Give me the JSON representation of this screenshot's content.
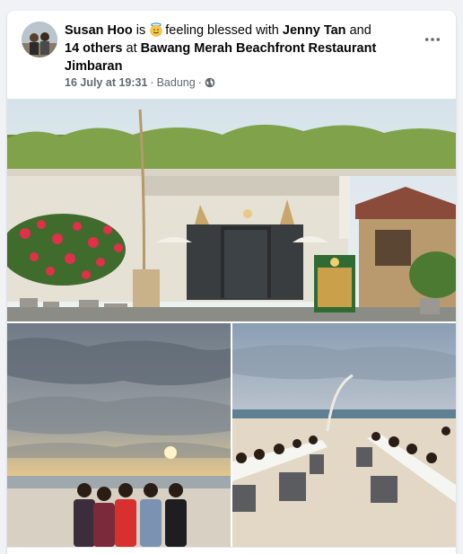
{
  "post": {
    "author": "Susan Hoo",
    "connector_is": "is",
    "activity": "feeling blessed",
    "feeling_icon": "smiling-face-with-halo-icon",
    "with_word": "with",
    "tagged_person": "Jenny Tan",
    "and_word": "and",
    "others": "14 others",
    "at_word": "at",
    "place": "Bawang Merah Beachfront Restaurant Jimbaran",
    "date": "16 July at 19:31",
    "separator": "·",
    "location": "Badung",
    "audience_separator": "·",
    "audience_icon": "globe-icon",
    "more_icon": "more-options-icon"
  },
  "photos": [
    {
      "subject": "restaurant-entrance-photo"
    },
    {
      "subject": "beach-sunset-group-photo"
    },
    {
      "subject": "beach-dinner-tables-photo"
    }
  ],
  "colors": {
    "text": "#050505",
    "muted": "#65676b",
    "background": "#f0f2f5",
    "card": "#ffffff"
  }
}
